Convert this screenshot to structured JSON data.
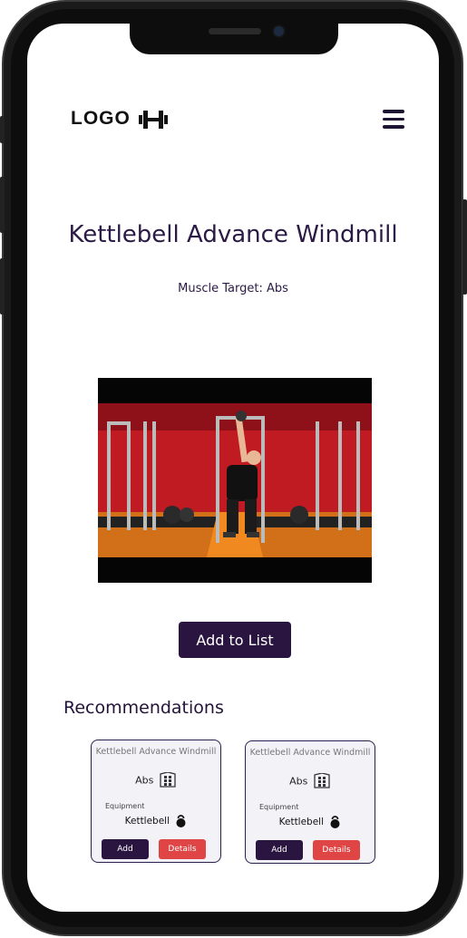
{
  "header": {
    "logo_text": "LOGO",
    "logo_icon": "dumbbell-icon",
    "menu_icon": "hamburger-menu-icon"
  },
  "exercise": {
    "title": "Kettlebell Advance Windmill",
    "muscle_target": "Muscle Target: Abs",
    "video_thumbnail": "man-performing-kettlebell-windmill-in-gym"
  },
  "actions": {
    "add_to_list_label": "Add to List"
  },
  "recommendations": {
    "heading": "Recommendations",
    "cards": [
      {
        "title": "Kettlebell Advance Windmill",
        "target": "Abs",
        "target_icon": "abs-muscle-icon",
        "equipment_label": "Equipment",
        "equipment": "Kettlebell",
        "equipment_icon": "kettlebell-icon",
        "add_label": "Add",
        "details_label": "Details"
      },
      {
        "title": "Kettlebell Advance Windmill",
        "target": "Abs",
        "target_icon": "abs-muscle-icon",
        "equipment_label": "Equipment",
        "equipment": "Kettlebell",
        "equipment_icon": "kettlebell-icon",
        "add_label": "Add",
        "details_label": "Details"
      }
    ]
  },
  "colors": {
    "primary": "#2a1540",
    "accent": "#e04545",
    "text": "#2a1a45"
  }
}
